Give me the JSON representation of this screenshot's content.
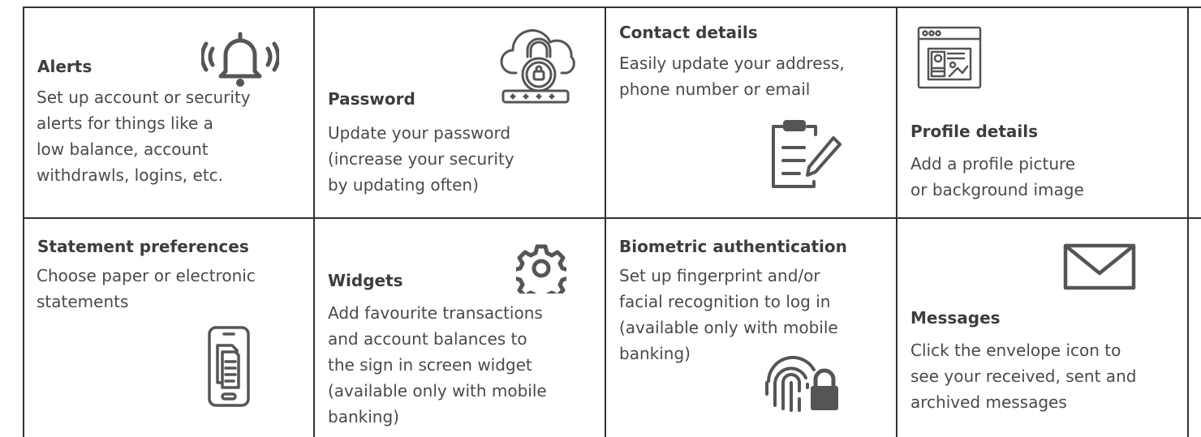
{
  "tiles": [
    {
      "title": "Alerts",
      "lines": [
        "Set up account or security",
        "alerts for things like a",
        "low balance, account",
        "withdrawls, logins, etc."
      ],
      "icon": "bell-ringing-icon"
    },
    {
      "title": "Password",
      "lines": [
        "Update your password",
        "(increase your security",
        "by updating often)"
      ],
      "icon": "cloud-lock-password-icon"
    },
    {
      "title": "Contact details",
      "lines": [
        "Easily update your address,",
        "phone number or email"
      ],
      "icon": "clipboard-pencil-icon"
    },
    {
      "title": "Profile details",
      "lines": [
        "Add a profile picture",
        "or background image"
      ],
      "icon": "browser-profile-icon"
    },
    {
      "title": "Statement preferences",
      "lines": [
        "Choose paper or electronic",
        "statements"
      ],
      "icon": "phone-documents-icon"
    },
    {
      "title": "Widgets",
      "lines": [
        "Add favourite transactions",
        "and account balances to",
        "the sign in screen widget",
        "(available only with mobile",
        "banking)"
      ],
      "icon": "gear-icon"
    },
    {
      "title": "Biometric authentication",
      "lines": [
        "Set up fingerprint and/or",
        "facial recognition to log in",
        "(available only with mobile",
        "banking)"
      ],
      "icon": "fingerprint-lock-icon"
    },
    {
      "title": "Messages",
      "lines": [
        "Click the envelope icon to",
        "see your received, sent and",
        "archived messages"
      ],
      "icon": "envelope-icon"
    }
  ],
  "colors": {
    "border": "#333333",
    "icon": "#555555",
    "text": "#4a4a4a"
  }
}
